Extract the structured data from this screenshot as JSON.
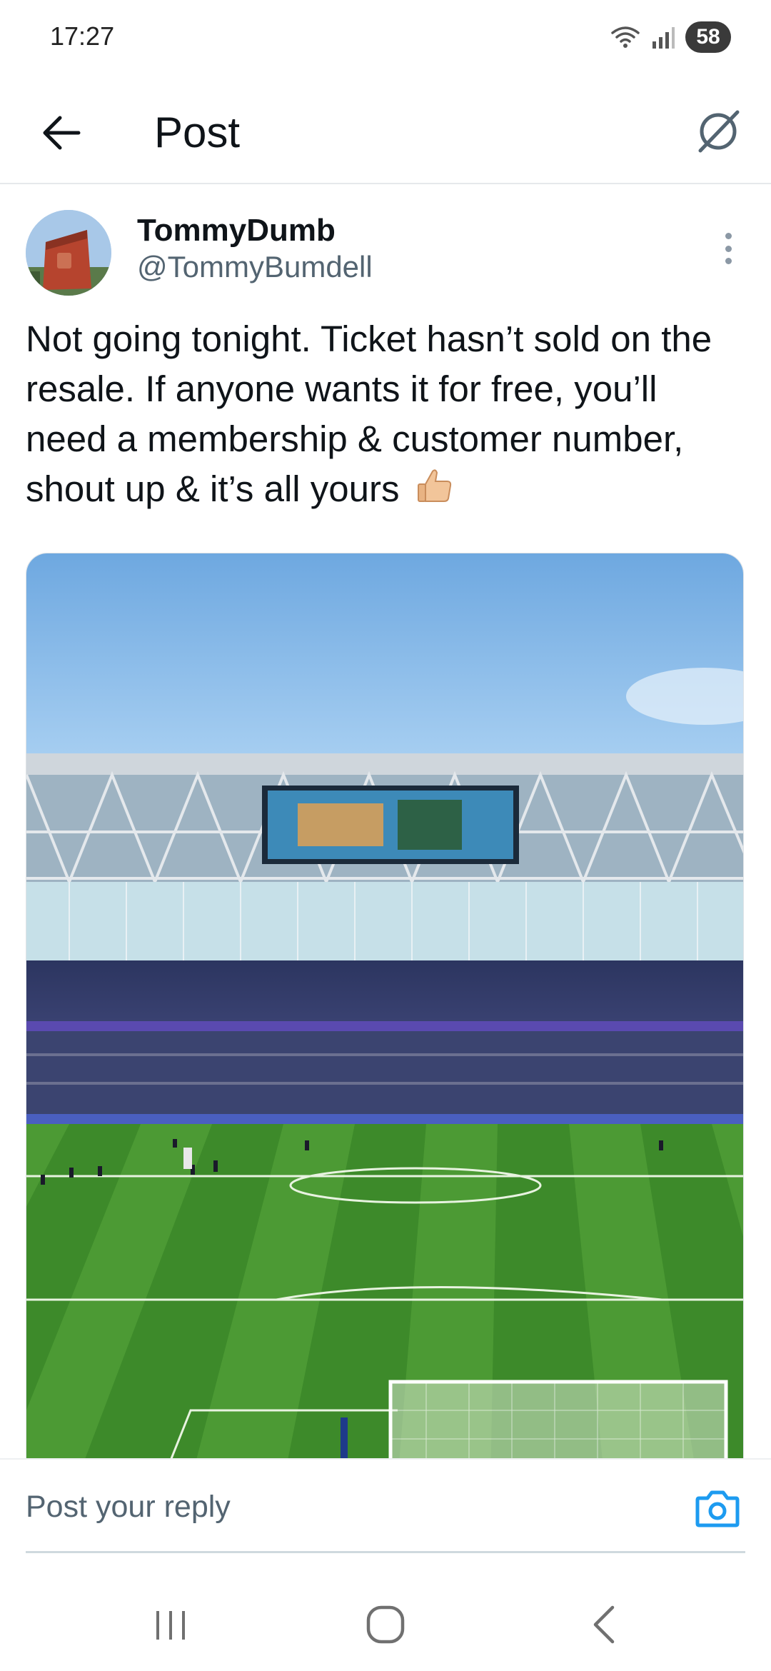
{
  "status_bar": {
    "time": "17:27",
    "battery": "58",
    "icons": [
      "wifi-icon",
      "signal-icon",
      "battery-icon"
    ]
  },
  "header": {
    "title": "Post",
    "back_icon": "arrow-left-icon",
    "grok_icon": "grok-icon"
  },
  "post": {
    "display_name": "TommyDumb",
    "handle": "@TommyBumdell",
    "text": "Not going tonight. Ticket hasn’t sold on the resale. If anyone wants it for free, you’ll need a membership & customer number, shout up & it’s all yours",
    "emoji": "thumbs-up",
    "media_icon": "stadium-photo"
  },
  "reply": {
    "placeholder": "Post your reply",
    "camera_icon": "camera-icon"
  },
  "nav": {
    "recent_icon": "recent-apps-icon",
    "home_icon": "home-icon",
    "back_icon": "back-chevron-icon"
  },
  "colors": {
    "accent": "#1d9bf0",
    "text_primary": "#0f1419",
    "text_secondary": "#536471",
    "pitch_light": "#4c9a34",
    "pitch_dark": "#3d8a2a",
    "sky": "#8fc0ea"
  }
}
